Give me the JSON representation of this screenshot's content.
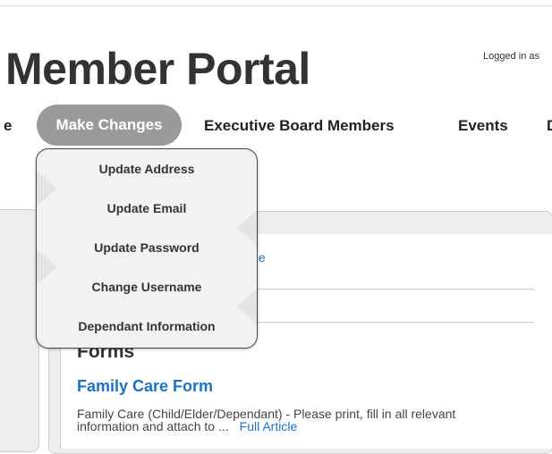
{
  "header": {
    "title": "Member Portal",
    "logged_in": "Logged in as"
  },
  "nav": {
    "partial_left": "e",
    "make_changes": "Make Changes",
    "executive": "Executive Board Members",
    "events": "Events",
    "partial_right": "D"
  },
  "dropdown": {
    "items": [
      "Update Address",
      "Update Email",
      "Update Password",
      "Change Username",
      "Dependant Information"
    ]
  },
  "content": {
    "partial_link": "iche",
    "section_heading": "Forms",
    "article_title": "Family Care Form",
    "article_body": "Family Care (Child/Elder/Dependant) - Please print, fill in all relevant information and attach to ...",
    "article_link": "Full Article"
  },
  "colors": {
    "active_tab": "#9a9a9a",
    "link": "#1a73c4",
    "panel": "#eeeeee"
  }
}
